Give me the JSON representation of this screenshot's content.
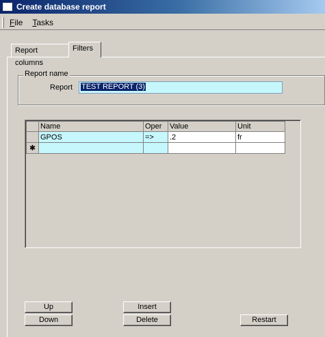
{
  "window": {
    "title": "Create database report"
  },
  "menu": {
    "file": {
      "mnemonic": "F",
      "rest": "ile"
    },
    "tasks": {
      "mnemonic": "T",
      "rest": "asks"
    }
  },
  "tabs": [
    {
      "label": "Report columns",
      "active": false
    },
    {
      "label": "Filters",
      "active": true
    }
  ],
  "report_name": {
    "group_label": "Report name",
    "field_label": "Report",
    "value": "TEST REPORT (3)"
  },
  "grid": {
    "columns": [
      "Name",
      "Oper",
      "Value",
      "Unit"
    ],
    "rows": [
      {
        "name": "GPOS",
        "oper": "=>",
        "value": ".2",
        "unit": "fr"
      }
    ],
    "new_row_marker": "✱"
  },
  "buttons": {
    "up": "Up",
    "down": "Down",
    "insert": "Insert",
    "delete": "Delete",
    "restart": "Restart"
  },
  "colors": {
    "window_bg": "#d4d0c8",
    "highlight_cell": "#c5f7fd",
    "title_gradient_start": "#0a246a",
    "selection": "#0a246a"
  }
}
